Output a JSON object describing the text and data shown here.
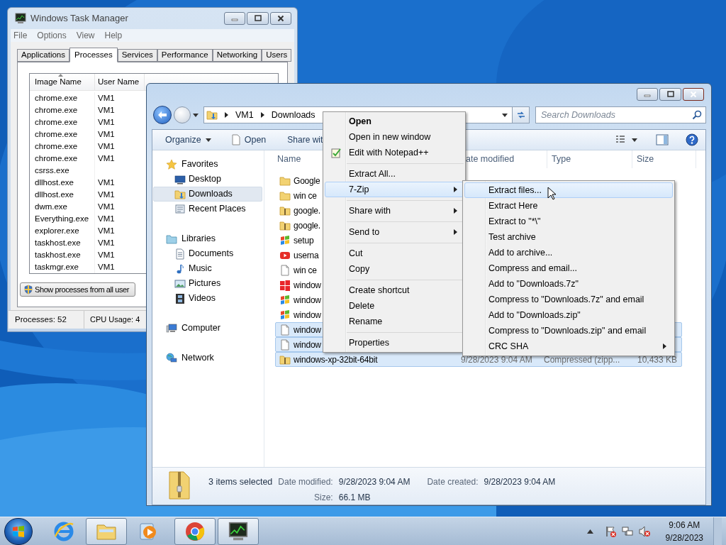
{
  "task_manager": {
    "title": "Windows Task Manager",
    "menu": [
      "File",
      "Options",
      "View",
      "Help"
    ],
    "tabs": [
      {
        "label": "Applications",
        "selected": false
      },
      {
        "label": "Processes",
        "selected": true
      },
      {
        "label": "Services",
        "selected": false
      },
      {
        "label": "Performance",
        "selected": false
      },
      {
        "label": "Networking",
        "selected": false
      },
      {
        "label": "Users",
        "selected": false
      }
    ],
    "columns": [
      "Image Name",
      "User Name"
    ],
    "rows": [
      {
        "image_name": "chrome.exe",
        "user_name": "VM1"
      },
      {
        "image_name": "chrome.exe",
        "user_name": "VM1"
      },
      {
        "image_name": "chrome.exe",
        "user_name": "VM1"
      },
      {
        "image_name": "chrome.exe",
        "user_name": "VM1"
      },
      {
        "image_name": "chrome.exe",
        "user_name": "VM1"
      },
      {
        "image_name": "chrome.exe",
        "user_name": "VM1"
      },
      {
        "image_name": "csrss.exe"
      },
      {
        "image_name": "dllhost.exe",
        "user_name": "VM1"
      },
      {
        "image_name": "dllhost.exe",
        "user_name": "VM1"
      },
      {
        "image_name": "dwm.exe",
        "user_name": "VM1"
      },
      {
        "image_name": "Everything.exe",
        "user_name": "VM1"
      },
      {
        "image_name": "explorer.exe",
        "user_name": "VM1"
      },
      {
        "image_name": "taskhost.exe",
        "user_name": "VM1"
      },
      {
        "image_name": "taskhost.exe",
        "user_name": "VM1"
      },
      {
        "image_name": "taskmgr.exe",
        "user_name": "VM1"
      }
    ],
    "button": "Show processes from all user",
    "status": [
      "Processes: 52",
      "CPU Usage: 4"
    ]
  },
  "explorer": {
    "breadcrumb": [
      "VM1",
      "Downloads"
    ],
    "search": {
      "placeholder": "Search Downloads"
    },
    "toolbar": [
      {
        "label": "Organize",
        "kind": "menu"
      },
      {
        "label": "Open",
        "kind": "open"
      },
      {
        "label": "Share wit",
        "kind": "plain"
      }
    ],
    "nav": [
      {
        "label": "Favorites",
        "kind": "favorites",
        "selected": false,
        "children": [
          {
            "label": "Desktop",
            "kind": "desktop",
            "selected": false
          },
          {
            "label": "Downloads",
            "kind": "downloads",
            "selected": true
          },
          {
            "label": "Recent Places",
            "kind": "recent",
            "selected": false
          }
        ]
      },
      {
        "label": "Libraries",
        "kind": "libraries",
        "selected": false,
        "children": [
          {
            "label": "Documents",
            "kind": "documents",
            "selected": false
          },
          {
            "label": "Music",
            "kind": "music",
            "selected": false
          },
          {
            "label": "Pictures",
            "kind": "pictures",
            "selected": false
          },
          {
            "label": "Videos",
            "kind": "videos",
            "selected": false
          }
        ]
      },
      {
        "label": "Computer",
        "kind": "computer",
        "selected": false
      },
      {
        "label": "Network",
        "kind": "network",
        "selected": false
      }
    ],
    "columns": [
      "Name",
      "ate modified",
      "Type",
      "Size"
    ],
    "files": [
      {
        "name": "Google",
        "kind": "folder",
        "selected": false
      },
      {
        "name": "win ce",
        "kind": "folder",
        "selected": false
      },
      {
        "name": "google.",
        "kind": "zip",
        "selected": false
      },
      {
        "name": "google.",
        "kind": "zip",
        "selected": false
      },
      {
        "name": "setup",
        "kind": "setup",
        "selected": false
      },
      {
        "name": "userna",
        "kind": "video",
        "selected": false
      },
      {
        "name": "win ce",
        "kind": "file",
        "selected": false
      },
      {
        "name": "window",
        "kind": "windows",
        "selected": false
      },
      {
        "name": "window",
        "kind": "setup",
        "selected": false
      },
      {
        "name": "window",
        "kind": "setup",
        "selected": false
      },
      {
        "name": "window",
        "kind": "file",
        "selected": true
      },
      {
        "name": "window",
        "kind": "file",
        "selected": true
      },
      {
        "name": "windows-xp-32bit-64bit",
        "kind": "zip",
        "selected": true,
        "date": "9/28/2023 9:04 AM",
        "type": "Compressed (zipp...",
        "size": "10,433 KB"
      }
    ],
    "details": {
      "summary": "3 items selected",
      "fields": [
        {
          "label": "Date modified:",
          "value": "9/28/2023 9:04 AM"
        },
        {
          "label": "Date created:",
          "value": "9/28/2023 9:04 AM"
        },
        {
          "label": "Size:",
          "value": "66.1 MB"
        }
      ]
    }
  },
  "context_menu": [
    {
      "label": "Open",
      "kind": "default",
      "selected": false,
      "submenu": false
    },
    {
      "label": "Open in new window",
      "kind": "item",
      "selected": false,
      "submenu": false
    },
    {
      "label": "Edit with Notepad++",
      "kind": "notepad",
      "selected": false,
      "submenu": false
    },
    {
      "kind": "separator"
    },
    {
      "label": "Extract All...",
      "kind": "item",
      "selected": false,
      "submenu": false
    },
    {
      "label": "7-Zip",
      "kind": "item",
      "selected": true,
      "submenu": true
    },
    {
      "kind": "separator"
    },
    {
      "label": "Share with",
      "kind": "item",
      "selected": false,
      "submenu": true
    },
    {
      "kind": "separator"
    },
    {
      "label": "Send to",
      "kind": "item",
      "selected": false,
      "submenu": true
    },
    {
      "kind": "separator"
    },
    {
      "label": "Cut",
      "kind": "item",
      "selected": false,
      "submenu": false
    },
    {
      "label": "Copy",
      "kind": "item",
      "selected": false,
      "submenu": false
    },
    {
      "kind": "separator"
    },
    {
      "label": "Create shortcut",
      "kind": "item",
      "selected": false,
      "submenu": false
    },
    {
      "label": "Delete",
      "kind": "item",
      "selected": false,
      "submenu": false
    },
    {
      "label": "Rename",
      "kind": "item",
      "selected": false,
      "submenu": false
    },
    {
      "kind": "separator"
    },
    {
      "label": "Properties",
      "kind": "item",
      "selected": false,
      "submenu": false
    }
  ],
  "zip_menu": [
    {
      "label": "Extract files...",
      "kind": "item",
      "selected": true,
      "submenu": false
    },
    {
      "label": "Extract Here",
      "kind": "item",
      "selected": false,
      "submenu": false
    },
    {
      "label": "Extract to \"*\\\"",
      "kind": "item",
      "selected": false,
      "submenu": false
    },
    {
      "label": "Test archive",
      "kind": "item",
      "selected": false,
      "submenu": false
    },
    {
      "label": "Add to archive...",
      "kind": "item",
      "selected": false,
      "submenu": false
    },
    {
      "label": "Compress and email...",
      "kind": "item",
      "selected": false,
      "submenu": false
    },
    {
      "label": "Add to \"Downloads.7z\"",
      "kind": "item",
      "selected": false,
      "submenu": false
    },
    {
      "label": "Compress to \"Downloads.7z\" and email",
      "kind": "item",
      "selected": false,
      "submenu": false
    },
    {
      "label": "Add to \"Downloads.zip\"",
      "kind": "item",
      "selected": false,
      "submenu": false
    },
    {
      "label": "Compress to \"Downloads.zip\" and email",
      "kind": "item",
      "selected": false,
      "submenu": false
    },
    {
      "label": "CRC SHA",
      "kind": "item",
      "selected": false,
      "submenu": true
    }
  ],
  "taskbar": {
    "apps": [
      {
        "kind": "ie",
        "running": false
      },
      {
        "kind": "explorer",
        "running": true
      },
      {
        "kind": "media",
        "running": false
      },
      {
        "kind": "chrome",
        "running": true
      },
      {
        "kind": "taskmgr",
        "running": true
      }
    ],
    "clock": {
      "time": "9:06 AM",
      "date": "9/28/2023"
    }
  }
}
